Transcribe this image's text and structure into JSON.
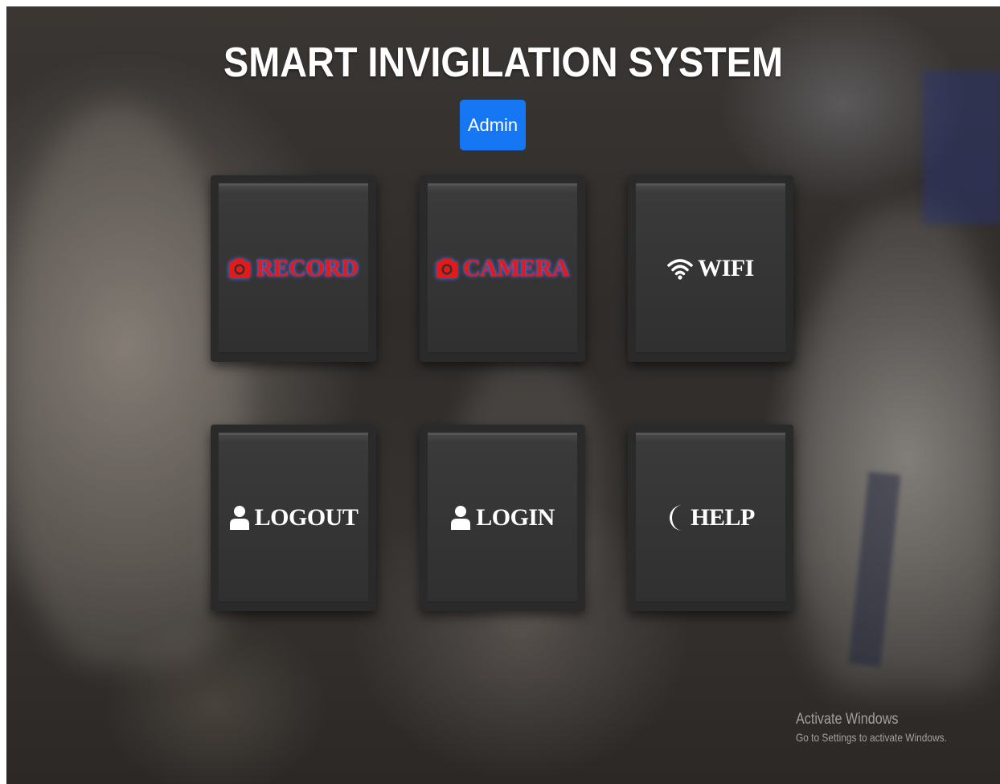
{
  "header": {
    "title": "SMART INVIGILATION SYSTEM",
    "admin_label": "Admin"
  },
  "tiles": [
    {
      "label": "RECORD",
      "icon": "camera-icon",
      "color": "#e41a1a"
    },
    {
      "label": "CAMERA",
      "icon": "camera-icon",
      "color": "#e41a1a"
    },
    {
      "label": "WIFI",
      "icon": "wifi-icon",
      "color": "#ffffff"
    },
    {
      "label": "LOGOUT",
      "icon": "user-icon",
      "color": "#ffffff"
    },
    {
      "label": "LOGIN",
      "icon": "user-icon",
      "color": "#ffffff"
    },
    {
      "label": "HELP",
      "icon": "moon-icon",
      "color": "#ffffff"
    }
  ],
  "watermark": {
    "title": "Activate Windows",
    "subtitle": "Go to Settings to activate Windows."
  },
  "colors": {
    "admin_button": "#1677f5",
    "tile_background": "#2a2a2a",
    "accent_red": "#e41a1a"
  }
}
